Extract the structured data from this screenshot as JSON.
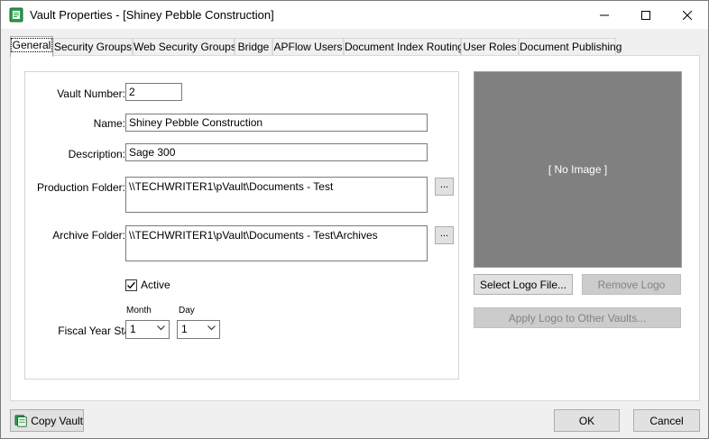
{
  "window": {
    "title": "Vault Properties - [Shiney Pebble Construction]"
  },
  "tabs": [
    {
      "label": "General",
      "active": true
    },
    {
      "label": "Security Groups"
    },
    {
      "label": "Web Security Groups"
    },
    {
      "label": "Bridge"
    },
    {
      "label": "APFlow Users"
    },
    {
      "label": "Document Index Routing"
    },
    {
      "label": "User Roles"
    },
    {
      "label": "Document Publishing"
    }
  ],
  "general": {
    "vault_number_label": "Vault Number:",
    "vault_number_value": "2",
    "name_label": "Name:",
    "name_value": "Shiney Pebble Construction",
    "description_label": "Description:",
    "description_value": "Sage 300",
    "production_folder_label": "Production Folder:",
    "production_folder_value": "\\\\TECHWRITER1\\pVault\\Documents - Test",
    "archive_folder_label": "Archive Folder:",
    "archive_folder_value": "\\\\TECHWRITER1\\pVault\\Documents - Test\\Archives",
    "browse_label": "...",
    "active_label": "Active",
    "active_checked": true,
    "month_label": "Month",
    "day_label": "Day",
    "fiscal_year_start_label": "Fiscal Year Start:",
    "month_value": "1",
    "day_value": "1"
  },
  "logo": {
    "placeholder": "[ No Image ]",
    "select_label": "Select Logo File...",
    "remove_label": "Remove Logo",
    "apply_label": "Apply Logo to Other Vaults..."
  },
  "footer": {
    "copy_vault_label": "Copy Vault",
    "ok_label": "OK",
    "cancel_label": "Cancel"
  },
  "colors": {
    "logo_bg": "#808080",
    "icon_green": "#1e8a3c"
  }
}
